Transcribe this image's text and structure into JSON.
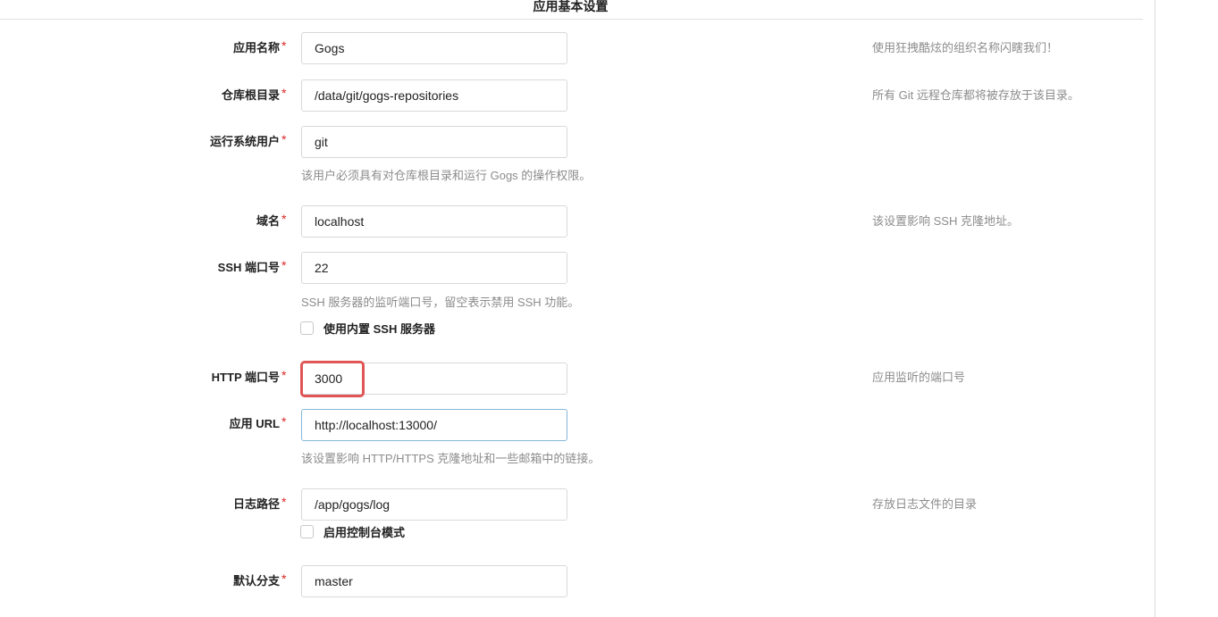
{
  "section_title": "应用基本设置",
  "fields": {
    "app_name": {
      "label": "应用名称",
      "value": "Gogs",
      "help": "使用狂拽酷炫的组织名称闪瞎我们！"
    },
    "repo_root": {
      "label": "仓库根目录",
      "value": "/data/git/gogs-repositories",
      "help": "所有 Git 远程仓库都将被存放于该目录。"
    },
    "run_user": {
      "label": "运行系统用户",
      "value": "git",
      "help": "该用户必须具有对仓库根目录和运行 Gogs 的操作权限。"
    },
    "domain": {
      "label": "域名",
      "value": "localhost",
      "help": "该设置影响 SSH 克隆地址。"
    },
    "ssh_port": {
      "label": "SSH 端口号",
      "value": "22",
      "help": "SSH 服务器的监听端口号，留空表示禁用 SSH 功能。"
    },
    "builtin_ssh": {
      "label": "使用内置 SSH 服务器"
    },
    "http_port": {
      "label": "HTTP 端口号",
      "value": "3000",
      "help": "应用监听的端口号"
    },
    "app_url": {
      "label": "应用 URL",
      "value": "http://localhost:13000/",
      "help": "该设置影响 HTTP/HTTPS 克隆地址和一些邮箱中的链接。"
    },
    "log_path": {
      "label": "日志路径",
      "value": "/app/gogs/log",
      "help": "存放日志文件的目录"
    },
    "console_mode": {
      "label": "启用控制台模式"
    },
    "default_branch": {
      "label": "默认分支",
      "value": "master"
    }
  },
  "required_mark": "*",
  "colors": {
    "required": "#db2828",
    "highlight": "#e05555",
    "focus_border": "#85b7d9"
  }
}
